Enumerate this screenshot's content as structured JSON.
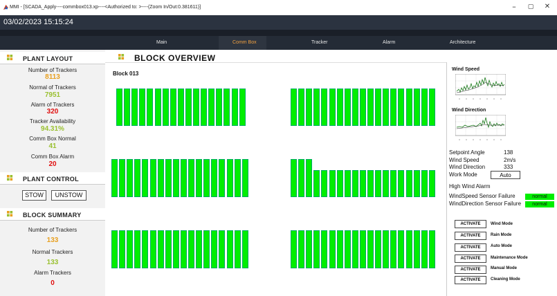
{
  "window": {
    "title": "MMI - [SCADA_Apply----commbox013.xp----<Authorized to: >----(Zoom In/Out:0.381611)]",
    "minimize": "–",
    "maximize": "▢",
    "close": "✕"
  },
  "datetime": "03/02/2023 15:15:24",
  "nav": {
    "tabs": [
      "Main",
      "Comm Box",
      "Tracker",
      "Alarm",
      "Architecture"
    ],
    "active": "Comm Box"
  },
  "plant_layout": {
    "title": "PLANT LAYOUT",
    "stats": [
      {
        "label": "Number of Trackers",
        "value": "8113",
        "color": "#e8a020"
      },
      {
        "label": "Normal of Trackers",
        "value": "7951",
        "color": "#9ac030"
      },
      {
        "label": "Alarm of Trackers",
        "value": "320",
        "color": "#e01010"
      },
      {
        "label": "Tracker Availability",
        "value": "94.31%",
        "color": "#9ac030"
      },
      {
        "label": "Comm Box Normal",
        "value": "41",
        "color": "#9ac030"
      },
      {
        "label": "Comm Box Alarm",
        "value": "20",
        "color": "#e01010"
      }
    ]
  },
  "plant_control": {
    "title": "PLANT CONTROL",
    "stow": "STOW",
    "unstow": "UNSTOW"
  },
  "block_summary": {
    "title": "BLOCK SUMMARY",
    "stats": [
      {
        "label": "Number of Trackers",
        "value": "133",
        "color": "#e8a020"
      },
      {
        "label": "Normal Trackers",
        "value": "133",
        "color": "#9ac030"
      },
      {
        "label": "Alarm Trackers",
        "value": "0",
        "color": "#e01010"
      }
    ]
  },
  "block_overview": {
    "title": "BLOCK OVERVIEW",
    "block_label": "Block 013",
    "tracker_color": "#00ee00"
  },
  "weather": {
    "wind_speed_title": "Wind Speed",
    "wind_direction_title": "Wind Direction",
    "setpoint_angle_label": "Setpoint Angle",
    "setpoint_angle_value": "138",
    "wind_speed_label": "Wind Speed",
    "wind_speed_value": "2m/s",
    "wind_direction_label": "Wind Direction",
    "wind_direction_value": "333",
    "work_mode_label": "Work Mode",
    "work_mode_value": "Auto",
    "high_wind_alarm": "High Wind Alarm",
    "windspeed_sensor_label": "WindSpeed Sensor Failure",
    "windspeed_sensor_status": "normal",
    "winddir_sensor_label": "WindDirection Sensor Failure",
    "winddir_sensor_status": "normal"
  },
  "modes": [
    {
      "button": "ACTIVATE",
      "label": "Wind Mode"
    },
    {
      "button": "ACTIVATE",
      "label": "Rain Mode"
    },
    {
      "button": "ACTIVATE",
      "label": "Auto Mode"
    },
    {
      "button": "ACTIVATE",
      "label": "Maintenance Mode"
    },
    {
      "button": "ACTIVATE",
      "label": "Manual Mode"
    },
    {
      "button": "ACTIVATE",
      "label": "Cleaning Mode"
    }
  ]
}
